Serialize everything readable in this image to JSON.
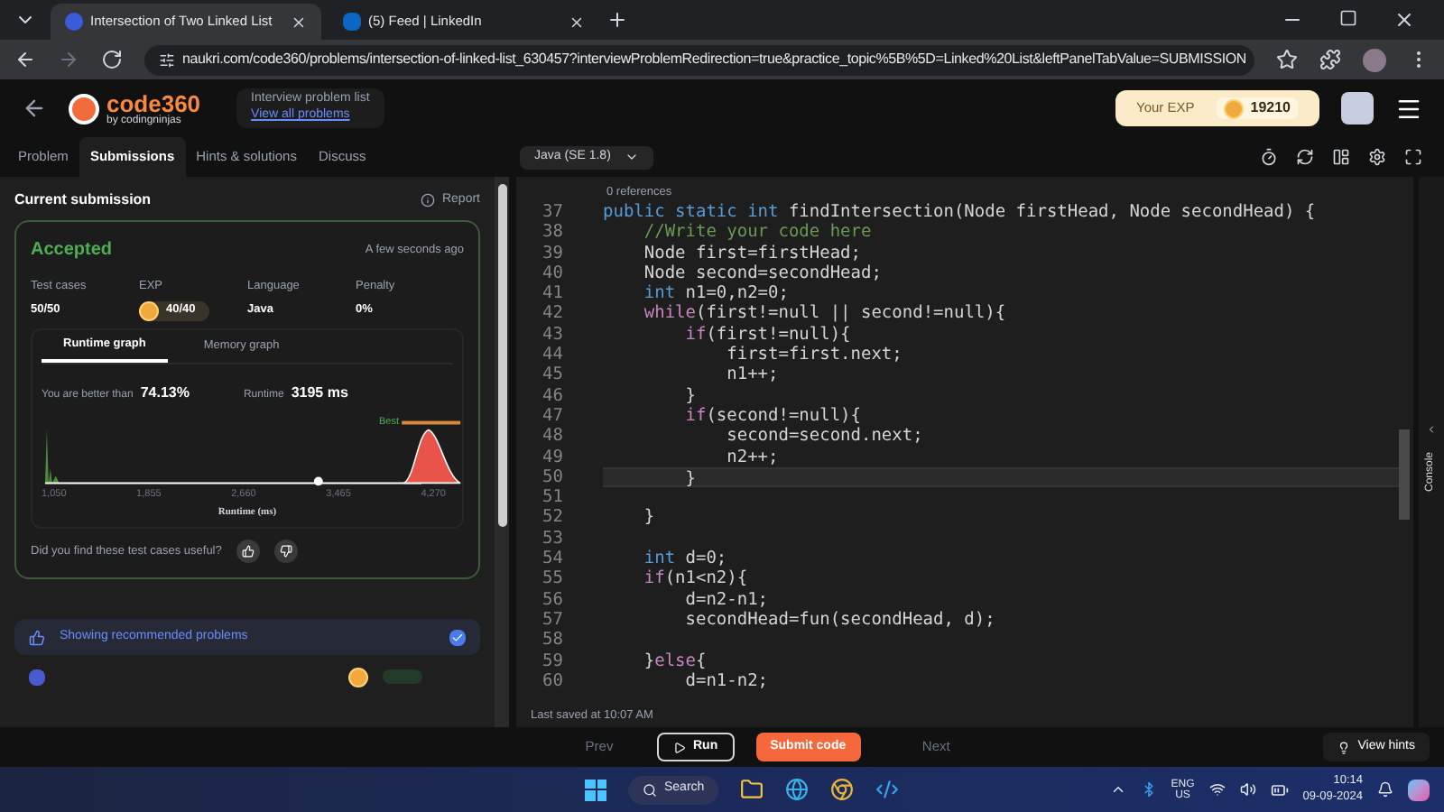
{
  "browser": {
    "tabs": [
      {
        "title": "Intersection of Two Linked List",
        "selected": true,
        "kind": "code360"
      },
      {
        "title": "(5) Feed | LinkedIn",
        "selected": false,
        "kind": "linkedin"
      }
    ],
    "url": "naukri.com/code360/problems/intersection-of-linked-list_630457?interviewProblemRedirection=true&practice_topic%5B%5D=Linked%20List&leftPanelTabValue=SUBMISSION"
  },
  "header": {
    "logo": "code360",
    "logo_sub": "by codingninjas",
    "list_title": "Interview problem list",
    "list_link": "View all problems",
    "exp_label": "Your EXP",
    "exp_value": "19210"
  },
  "panel_tabs": [
    {
      "label": "Problem",
      "selected": false
    },
    {
      "label": "Submissions",
      "selected": true
    },
    {
      "label": "Hints & solutions",
      "selected": false
    },
    {
      "label": "Discuss",
      "selected": false
    }
  ],
  "language": "Java (SE 1.8)",
  "submission": {
    "title": "Current submission",
    "report": "Report",
    "status": "Accepted",
    "time": "A few seconds ago",
    "stats": [
      {
        "label": "Test cases",
        "value": "50/50",
        "kind": "text"
      },
      {
        "label": "EXP",
        "value": "40/40",
        "kind": "coin"
      },
      {
        "label": "Language",
        "value": "Java",
        "kind": "text"
      },
      {
        "label": "Penalty",
        "value": "0%",
        "kind": "text"
      }
    ],
    "graph_tabs": [
      {
        "label": "Runtime graph",
        "selected": true
      },
      {
        "label": "Memory graph",
        "selected": false
      }
    ],
    "better_label": "You are better than",
    "better_value": "74.13%",
    "runtime_label": "Runtime",
    "runtime_value": "3195 ms",
    "best_label": "Best",
    "x_ticks": [
      "1,050",
      "1,855",
      "2,660",
      "3,465",
      "4,270"
    ],
    "xlabel": "Runtime (ms)",
    "feedback": "Did you find these test cases useful?"
  },
  "recommended": {
    "label": "Showing recommended problems",
    "checked": true
  },
  "editor": {
    "references": "0 references",
    "lines": [
      {
        "num": "37",
        "current": false,
        "tokens": [
          {
            "kind": "kw",
            "t": "public static int"
          },
          {
            "kind": "tx",
            "t": " findIntersection(Node firstHead, Node secondHead) {"
          }
        ]
      },
      {
        "num": "38",
        "current": false,
        "tokens": [
          {
            "kind": "cm",
            "t": "    //Write your code here"
          }
        ]
      },
      {
        "num": "39",
        "current": false,
        "tokens": [
          {
            "kind": "tx",
            "t": "    Node first=firstHead;"
          }
        ]
      },
      {
        "num": "40",
        "current": false,
        "tokens": [
          {
            "kind": "tx",
            "t": "    Node second=secondHead;"
          }
        ]
      },
      {
        "num": "41",
        "current": false,
        "tokens": [
          {
            "kind": "kw",
            "t": "    int"
          },
          {
            "kind": "tx",
            "t": " n1=0,n2=0;"
          }
        ]
      },
      {
        "num": "42",
        "current": false,
        "tokens": [
          {
            "kind": "ctl",
            "t": "    while"
          },
          {
            "kind": "tx",
            "t": "(first!=null || second!=null){"
          }
        ]
      },
      {
        "num": "43",
        "current": false,
        "tokens": [
          {
            "kind": "ctl",
            "t": "        if"
          },
          {
            "kind": "tx",
            "t": "(first!=null){"
          }
        ]
      },
      {
        "num": "44",
        "current": false,
        "tokens": [
          {
            "kind": "tx",
            "t": "            first=first.next;"
          }
        ]
      },
      {
        "num": "45",
        "current": false,
        "tokens": [
          {
            "kind": "tx",
            "t": "            n1++;"
          }
        ]
      },
      {
        "num": "46",
        "current": false,
        "tokens": [
          {
            "kind": "tx",
            "t": "        }"
          }
        ]
      },
      {
        "num": "47",
        "current": false,
        "tokens": [
          {
            "kind": "ctl",
            "t": "        if"
          },
          {
            "kind": "tx",
            "t": "(second!=null){"
          }
        ]
      },
      {
        "num": "48",
        "current": false,
        "tokens": [
          {
            "kind": "tx",
            "t": "            second=second.next;"
          }
        ]
      },
      {
        "num": "49",
        "current": false,
        "tokens": [
          {
            "kind": "tx",
            "t": "            n2++;"
          }
        ]
      },
      {
        "num": "50",
        "current": true,
        "tokens": [
          {
            "kind": "tx",
            "t": "        }"
          }
        ]
      },
      {
        "num": "51",
        "current": false
      },
      {
        "num": "52",
        "current": false,
        "tokens": [
          {
            "kind": "tx",
            "t": "    }"
          }
        ]
      },
      {
        "num": "53",
        "current": false
      },
      {
        "num": "54",
        "current": false,
        "tokens": [
          {
            "kind": "kw",
            "t": "    int"
          },
          {
            "kind": "tx",
            "t": " d=0;"
          }
        ]
      },
      {
        "num": "55",
        "current": false,
        "tokens": [
          {
            "kind": "ctl",
            "t": "    if"
          },
          {
            "kind": "tx",
            "t": "(n1<n2){"
          }
        ]
      },
      {
        "num": "56",
        "current": false,
        "tokens": [
          {
            "kind": "tx",
            "t": "        d=n2-n1;"
          }
        ]
      },
      {
        "num": "57",
        "current": false,
        "tokens": [
          {
            "kind": "tx",
            "t": "        secondHead=fun(secondHead, d);"
          }
        ]
      },
      {
        "num": "58",
        "current": false
      },
      {
        "num": "59",
        "current": false,
        "tokens": [
          {
            "kind": "tx",
            "t": "    }"
          },
          {
            "kind": "ctl",
            "t": "else"
          },
          {
            "kind": "tx",
            "t": "{"
          }
        ]
      },
      {
        "num": "60",
        "current": false,
        "tokens": [
          {
            "kind": "tx",
            "t": "        d=n1-n2;"
          }
        ]
      }
    ],
    "saved": "Last saved at 10:07 AM",
    "console": "Console"
  },
  "actions": {
    "prev": "Prev",
    "run": "Run",
    "submit": "Submit code",
    "next": "Next",
    "hints": "View hints"
  },
  "taskbar": {
    "search": "Search",
    "lang": "ENG",
    "region": "US",
    "time": "10:14",
    "date": "09-09-2024"
  }
}
